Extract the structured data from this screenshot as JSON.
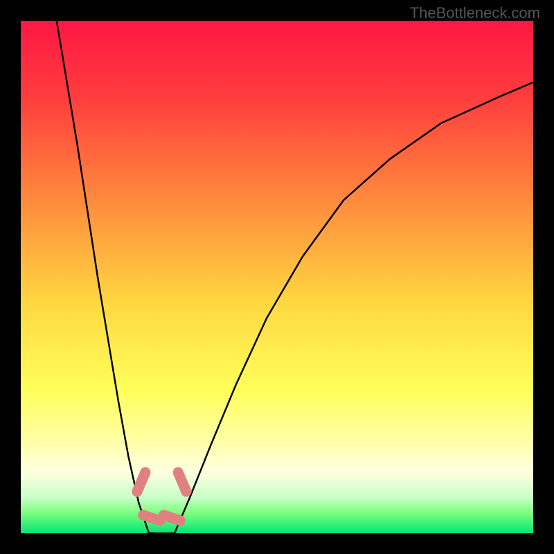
{
  "watermark": "TheBottleneck.com",
  "chart_data": {
    "type": "line",
    "title": "",
    "xlabel": "",
    "ylabel": "",
    "xlim": [
      0,
      100
    ],
    "ylim": [
      0,
      100
    ],
    "gradient_stops": [
      {
        "offset": 0.0,
        "color": "#ff1744"
      },
      {
        "offset": 0.15,
        "color": "#ff3d3d"
      },
      {
        "offset": 0.35,
        "color": "#ff8a3d"
      },
      {
        "offset": 0.55,
        "color": "#ffd740"
      },
      {
        "offset": 0.72,
        "color": "#ffff59"
      },
      {
        "offset": 0.82,
        "color": "#ffffa8"
      },
      {
        "offset": 0.88,
        "color": "#ffffe0"
      },
      {
        "offset": 0.93,
        "color": "#c8ffc8"
      },
      {
        "offset": 0.96,
        "color": "#7fff7f"
      },
      {
        "offset": 1.0,
        "color": "#00e676"
      }
    ],
    "series": [
      {
        "name": "left_branch",
        "x": [
          7,
          9,
          11,
          13,
          15,
          17,
          19,
          21,
          23,
          25
        ],
        "y": [
          100,
          88,
          76,
          63,
          50,
          38,
          26,
          15,
          6,
          0
        ]
      },
      {
        "name": "right_branch",
        "x": [
          30,
          33,
          37,
          42,
          48,
          55,
          63,
          72,
          82,
          93,
          100
        ],
        "y": [
          0,
          7,
          17,
          29,
          42,
          54,
          65,
          73,
          80,
          85,
          88
        ]
      }
    ],
    "trough": {
      "x_range": [
        25,
        30
      ],
      "y": 0
    },
    "markers": [
      {
        "x": 23.5,
        "y": 10,
        "label": "marker-left-upper"
      },
      {
        "x": 25.5,
        "y": 3,
        "label": "marker-left-lower"
      },
      {
        "x": 29.5,
        "y": 3,
        "label": "marker-right-lower"
      },
      {
        "x": 31.5,
        "y": 10,
        "label": "marker-right-upper"
      }
    ],
    "marker_color": "#e08080"
  }
}
